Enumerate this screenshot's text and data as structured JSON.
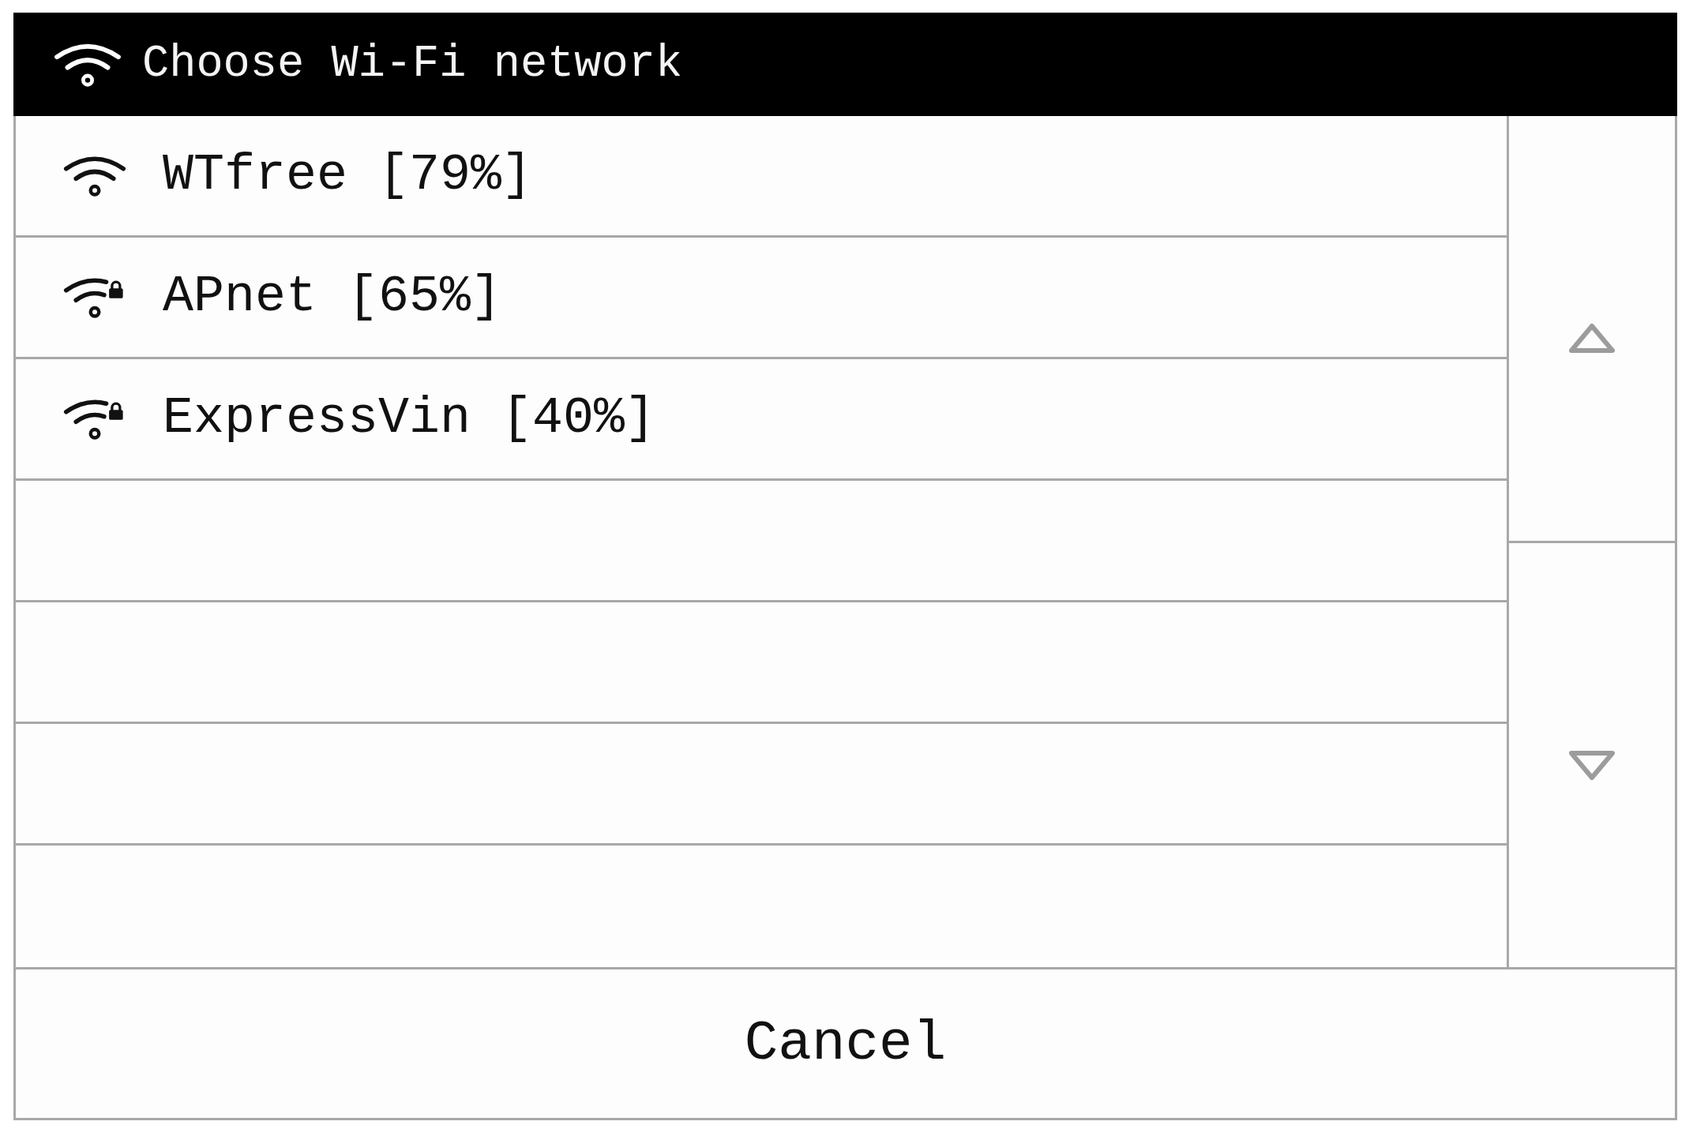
{
  "window": {
    "title": "Choose Wi-Fi network"
  },
  "networks": [
    {
      "name": "WTfree [79%]",
      "secured": false
    },
    {
      "name": "APnet [65%]",
      "secured": true
    },
    {
      "name": "ExpressVin [40%]",
      "secured": true
    }
  ],
  "cancel_button": {
    "label": "Cancel"
  }
}
